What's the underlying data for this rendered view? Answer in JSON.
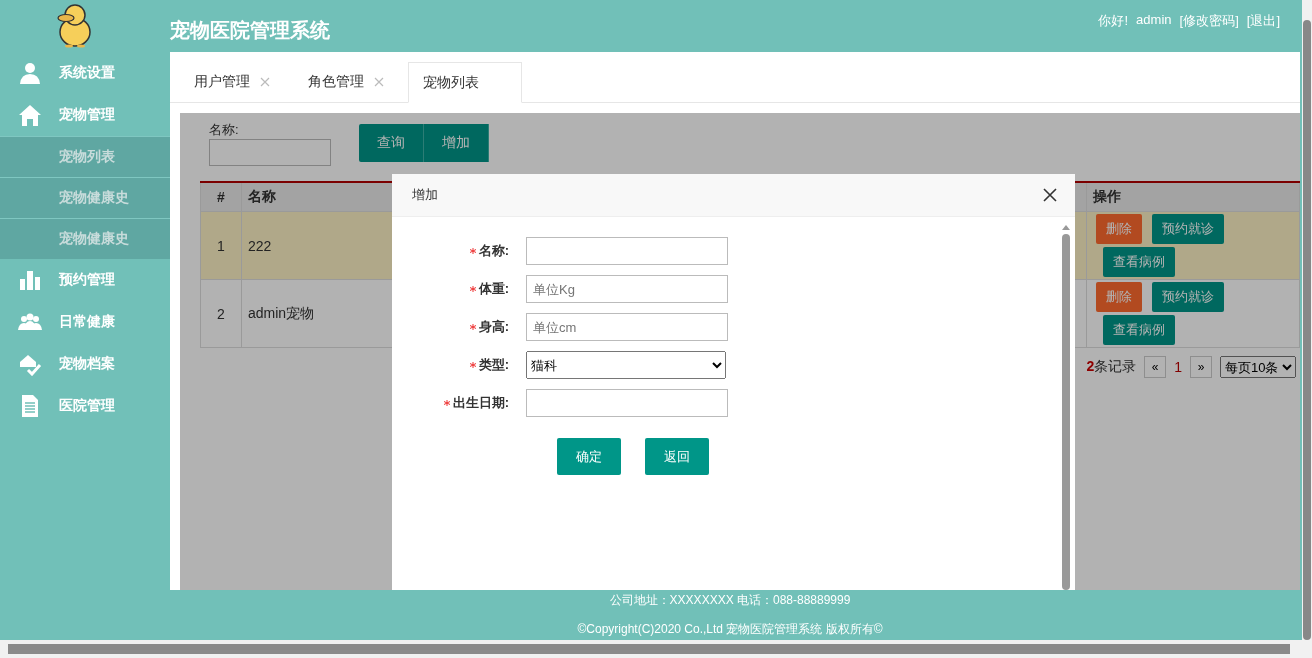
{
  "header": {
    "title": "宠物医院管理系统",
    "greeting": "你好!",
    "user": "admin",
    "links": [
      "[修改密码]",
      "[退出]"
    ]
  },
  "sidebar": {
    "items": [
      {
        "label": "系统设置",
        "kind": "user"
      },
      {
        "label": "宠物管理",
        "kind": "home",
        "children": [
          {
            "label": "宠物列表"
          },
          {
            "label": "宠物健康史"
          },
          {
            "label": "宠物健康史"
          }
        ]
      },
      {
        "label": "预约管理",
        "kind": "chart"
      },
      {
        "label": "日常健康",
        "kind": "group"
      },
      {
        "label": "宠物档案",
        "kind": "check"
      },
      {
        "label": "医院管理",
        "kind": "doc"
      }
    ]
  },
  "tabs": [
    {
      "label": "用户管理",
      "selected": false,
      "closable": true
    },
    {
      "label": "角色管理",
      "selected": false,
      "closable": true
    },
    {
      "label": "宠物列表",
      "selected": true,
      "closable": false
    }
  ],
  "search": {
    "label": "名称:",
    "buttons": [
      "查询",
      "增加"
    ]
  },
  "table": {
    "columns": [
      "#",
      "名称",
      "操作"
    ],
    "rows": [
      {
        "cells": [
          "1",
          "222"
        ],
        "selected": true,
        "actions": [
          {
            "label": "删除",
            "kind": "danger"
          },
          {
            "label": "预约就诊",
            "kind": "normal"
          },
          {
            "label": "查看病例",
            "kind": "normal"
          }
        ]
      },
      {
        "cells": [
          "2",
          "admin宠物"
        ],
        "selected": false,
        "actions": [
          {
            "label": "删除",
            "kind": "danger"
          },
          {
            "label": "预约就诊",
            "kind": "normal"
          },
          {
            "label": "查看病例",
            "kind": "normal"
          }
        ]
      }
    ]
  },
  "pagination": {
    "total": "**2**条记录",
    "prev": "«",
    "page": "1",
    "next": "»",
    "page_size": "每页10条"
  },
  "dialog": {
    "title": "增加",
    "fields": [
      {
        "label": "名称:",
        "required": true,
        "kind": "text"
      },
      {
        "label": "体重:",
        "required": true,
        "kind": "text",
        "placeholder": "单位Kg"
      },
      {
        "label": "身高:",
        "required": true,
        "kind": "text",
        "placeholder": "单位cm"
      },
      {
        "label": "类型:",
        "required": true,
        "kind": "select",
        "value": "猫科"
      },
      {
        "label": "出生日期:",
        "required": true,
        "kind": "text"
      }
    ],
    "buttons": [
      "确定",
      "返回"
    ]
  },
  "footer": {
    "lines": [
      "公司地址：XXXXXXXX 电话：088-88889999",
      "©Copyright(C)2020 Co.,Ltd 宠物医院管理系统 版权所有©"
    ]
  }
}
